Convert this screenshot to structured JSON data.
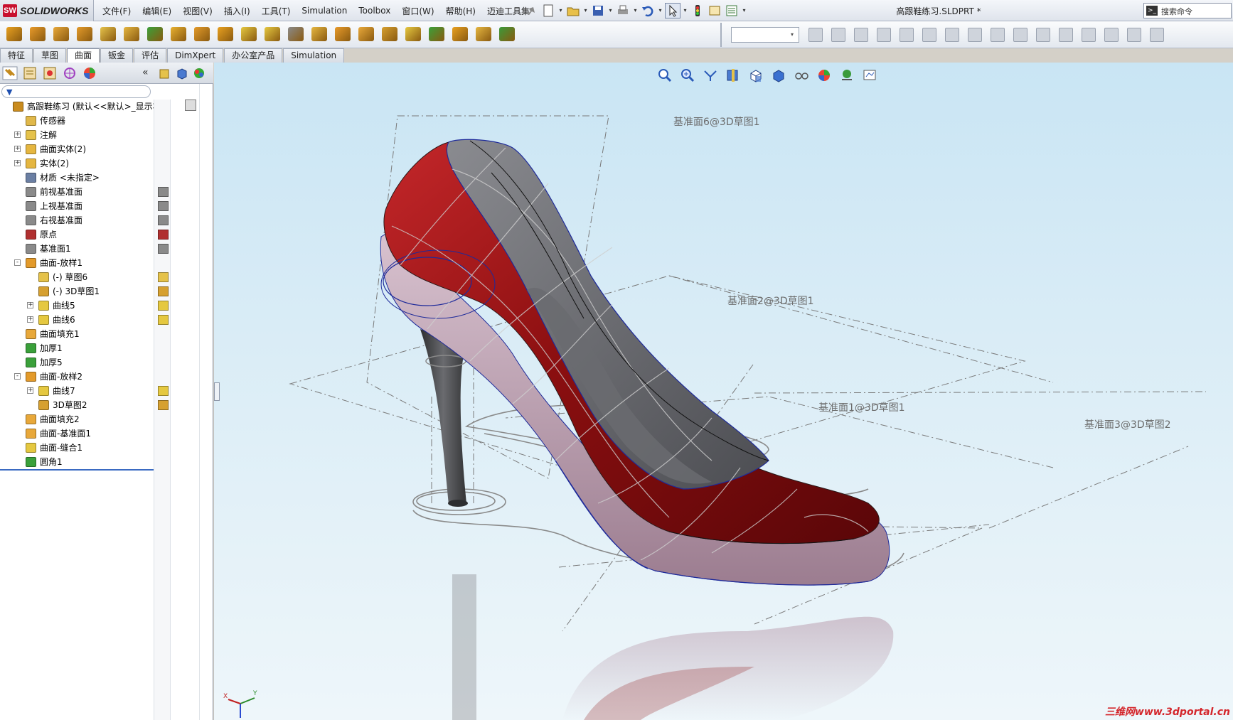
{
  "app": {
    "brand": "SOLIDWORKS",
    "brand_mark": "SW",
    "document_title": "高跟鞋练习.SLDPRT *",
    "search_placeholder": "搜索命令"
  },
  "menu": [
    "文件(F)",
    "编辑(E)",
    "视图(V)",
    "插入(I)",
    "工具(T)",
    "Simulation",
    "Toolbox",
    "窗口(W)",
    "帮助(H)",
    "迈迪工具集"
  ],
  "command_tabs": [
    {
      "label": "特征",
      "active": false
    },
    {
      "label": "草图",
      "active": false
    },
    {
      "label": "曲面",
      "active": true
    },
    {
      "label": "钣金",
      "active": false
    },
    {
      "label": "评估",
      "active": false
    },
    {
      "label": "DimXpert",
      "active": false
    },
    {
      "label": "办公室产品",
      "active": false
    },
    {
      "label": "Simulation",
      "active": false
    }
  ],
  "feature_tree": {
    "filter_icon": "filter-icon",
    "collapse_label": "«",
    "items": [
      {
        "label": "高跟鞋练习  (默认<<默认>_显示状",
        "indent": 0,
        "expander": "",
        "icon": "part-icon",
        "color": "#c98b1e"
      },
      {
        "label": "传感器",
        "indent": 1,
        "expander": "",
        "icon": "sensor-icon",
        "color": "#e0b84a"
      },
      {
        "label": "注解",
        "indent": 1,
        "expander": "+",
        "icon": "annotation-icon",
        "color": "#e5c24a"
      },
      {
        "label": "曲面实体(2)",
        "indent": 1,
        "expander": "+",
        "icon": "surface-bodies-folder-icon",
        "color": "#e5b640"
      },
      {
        "label": "实体(2)",
        "indent": 1,
        "expander": "+",
        "icon": "solid-bodies-folder-icon",
        "color": "#e5b640"
      },
      {
        "label": "材质 <未指定>",
        "indent": 1,
        "expander": "",
        "icon": "material-icon",
        "color": "#6b7fa3"
      },
      {
        "label": "前视基准面",
        "indent": 1,
        "expander": "",
        "icon": "plane-icon",
        "color": "#8a8a8a"
      },
      {
        "label": "上视基准面",
        "indent": 1,
        "expander": "",
        "icon": "plane-icon",
        "color": "#8a8a8a"
      },
      {
        "label": "右视基准面",
        "indent": 1,
        "expander": "",
        "icon": "plane-icon",
        "color": "#8a8a8a"
      },
      {
        "label": "原点",
        "indent": 1,
        "expander": "",
        "icon": "origin-icon",
        "color": "#b03030"
      },
      {
        "label": "基准面1",
        "indent": 1,
        "expander": "",
        "icon": "plane-icon",
        "color": "#8a8a8a"
      },
      {
        "label": "曲面-放样1",
        "indent": 1,
        "expander": "-",
        "icon": "surface-loft-icon",
        "color": "#e39a2a"
      },
      {
        "label": "(-) 草图6",
        "indent": 2,
        "expander": "",
        "icon": "sketch-icon",
        "color": "#e5c24a"
      },
      {
        "label": "(-) 3D草图1",
        "indent": 2,
        "expander": "",
        "icon": "3d-sketch-icon",
        "color": "#d6a030"
      },
      {
        "label": "曲线5",
        "indent": 2,
        "expander": "+",
        "icon": "curve-icon",
        "color": "#e5c840"
      },
      {
        "label": "曲线6",
        "indent": 2,
        "expander": "+",
        "icon": "curve-icon",
        "color": "#e5c840"
      },
      {
        "label": "曲面填充1",
        "indent": 1,
        "expander": "",
        "icon": "surface-fill-icon",
        "color": "#e8a83a"
      },
      {
        "label": "加厚1",
        "indent": 1,
        "expander": "",
        "icon": "thicken-icon",
        "color": "#3aa03a"
      },
      {
        "label": "加厚5",
        "indent": 1,
        "expander": "",
        "icon": "thicken-icon",
        "color": "#3aa03a"
      },
      {
        "label": "曲面-放样2",
        "indent": 1,
        "expander": "-",
        "icon": "surface-loft-icon",
        "color": "#e39a2a"
      },
      {
        "label": "曲线7",
        "indent": 2,
        "expander": "+",
        "icon": "curve-icon",
        "color": "#e5c840"
      },
      {
        "label": "3D草图2",
        "indent": 2,
        "expander": "",
        "icon": "3d-sketch-icon",
        "color": "#d6a030"
      },
      {
        "label": "曲面填充2",
        "indent": 1,
        "expander": "",
        "icon": "surface-fill-icon",
        "color": "#e8a83a"
      },
      {
        "label": "曲面-基准面1",
        "indent": 1,
        "expander": "",
        "icon": "planar-surface-icon",
        "color": "#e8a83a"
      },
      {
        "label": "曲面-缝合1",
        "indent": 1,
        "expander": "",
        "icon": "knit-surface-icon",
        "color": "#e5c840"
      },
      {
        "label": "圆角1",
        "indent": 1,
        "expander": "",
        "icon": "fillet-icon",
        "color": "#3aa03a"
      }
    ]
  },
  "viewport": {
    "plane_labels": [
      {
        "text": "基准面6@3D草图1"
      },
      {
        "text": "基准面2@3D草图1"
      },
      {
        "text": "基准面1@3D草图1"
      },
      {
        "text": "基准面3@3D草图2"
      }
    ],
    "triad_labels": {
      "x": "X",
      "y": "Y"
    },
    "watermark": "三维网www.3dportal.cn",
    "colors": {
      "shoe_red": "#8b0f10",
      "shoe_inner": "#5d5f63",
      "shoe_sole": "#b89aab",
      "heel": "#4a4b4e",
      "edge": "#1e2a9a"
    }
  }
}
